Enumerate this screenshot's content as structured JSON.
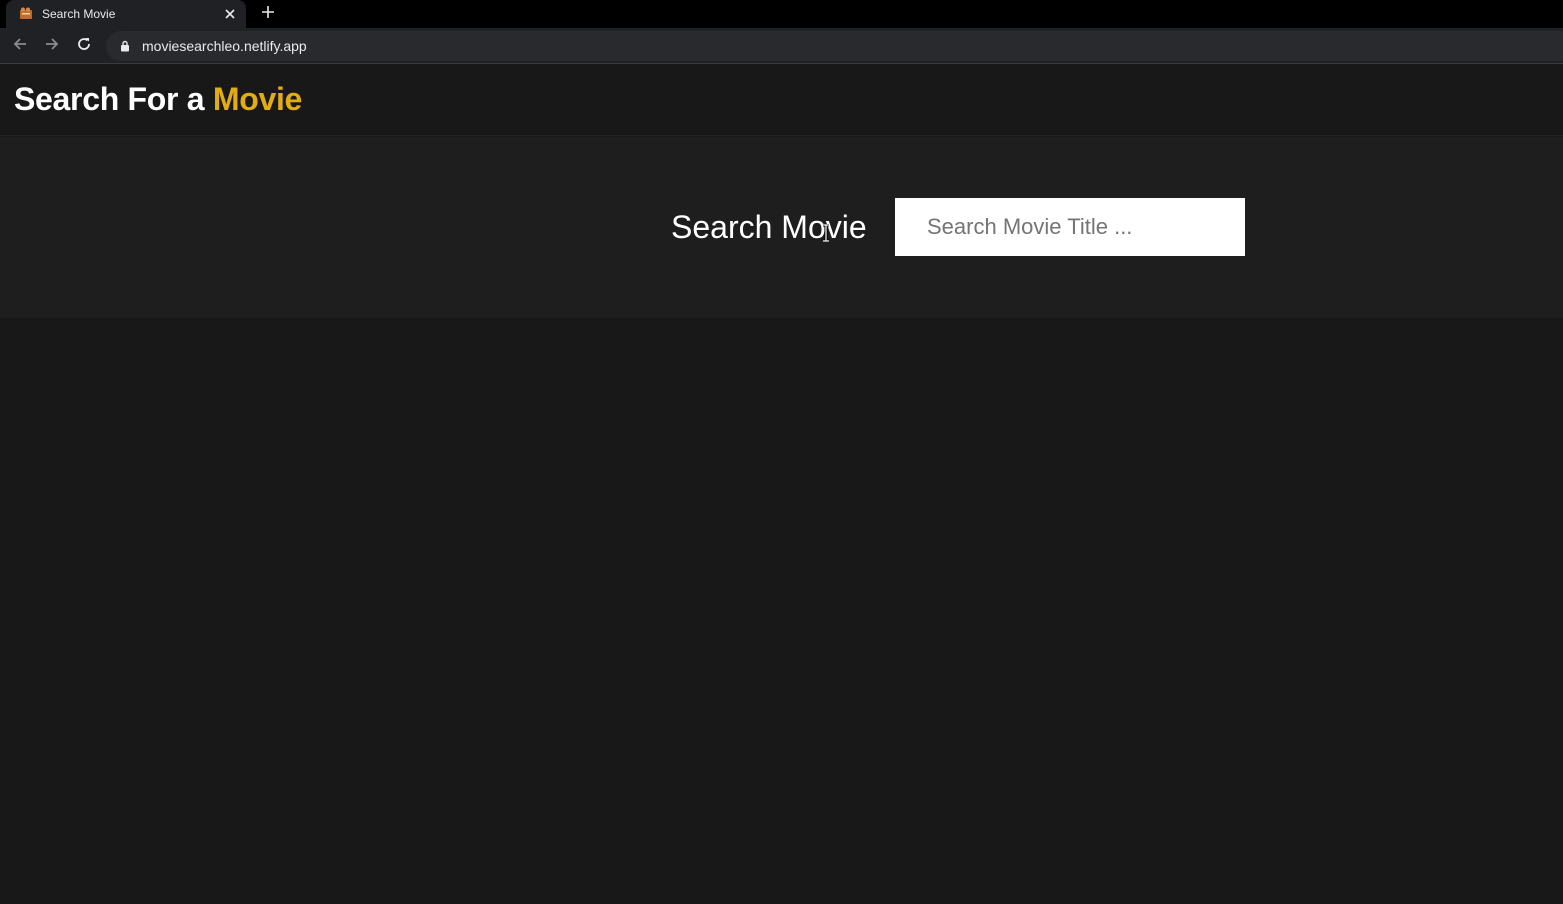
{
  "browser": {
    "tab": {
      "title": "Search Movie",
      "favicon": "movie-favicon-icon"
    },
    "url": "moviesearchleo.netlify.app",
    "icons": {
      "back": "back-arrow-icon",
      "forward": "forward-arrow-icon",
      "reload": "reload-icon",
      "lock": "lock-icon",
      "close": "close-icon",
      "new_tab": "plus-icon"
    }
  },
  "header": {
    "title_prefix": "Search For a ",
    "title_accent": "Movie"
  },
  "search": {
    "label": "Search Movie",
    "placeholder": "Search Movie Title ...",
    "value": ""
  },
  "colors": {
    "accent": "#e2ad12",
    "background": "#181818",
    "search_band": "#1e1e1e"
  }
}
